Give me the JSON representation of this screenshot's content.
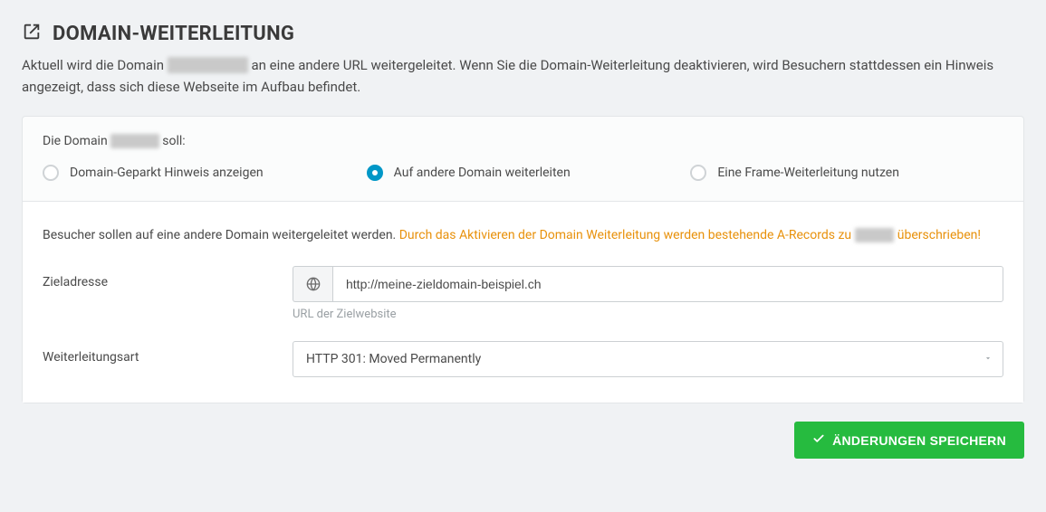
{
  "header": {
    "title": "DOMAIN-WEITERLEITUNG",
    "desc_p1": "Aktuell wird die Domain",
    "desc_domain": "████████",
    "desc_p2": "an eine andere URL weitergeleitet. Wenn Sie die Domain-Weiterleitung deaktivieren, wird Besuchern stattdessen ein Hinweis angezeigt, dass sich diese Webseite im Aufbau befindet."
  },
  "card": {
    "prompt_p1": "Die Domain",
    "prompt_domain": "█████",
    "prompt_p2": "soll:",
    "options": {
      "parked": "Domain-Geparkt Hinweis anzeigen",
      "redirect": "Auf andere Domain weiterleiten",
      "frame": "Eine Frame-Weiterleitung nutzen"
    },
    "info_text": "Besucher sollen auf eine andere Domain weitergeleitet werden.",
    "warn_p1": "Durch das Aktivieren der Domain Weiterleitung werden bestehende A-Records zu",
    "warn_domain": "████",
    "warn_p2": "überschrieben!",
    "target_label": "Zieladresse",
    "target_value": "http://meine-zieldomain-beispiel.ch",
    "target_help": "URL der Zielwebsite",
    "type_label": "Weiterleitungsart",
    "type_value": "HTTP 301: Moved Permanently"
  },
  "actions": {
    "save_label": "ÄNDERUNGEN SPEICHERN"
  }
}
